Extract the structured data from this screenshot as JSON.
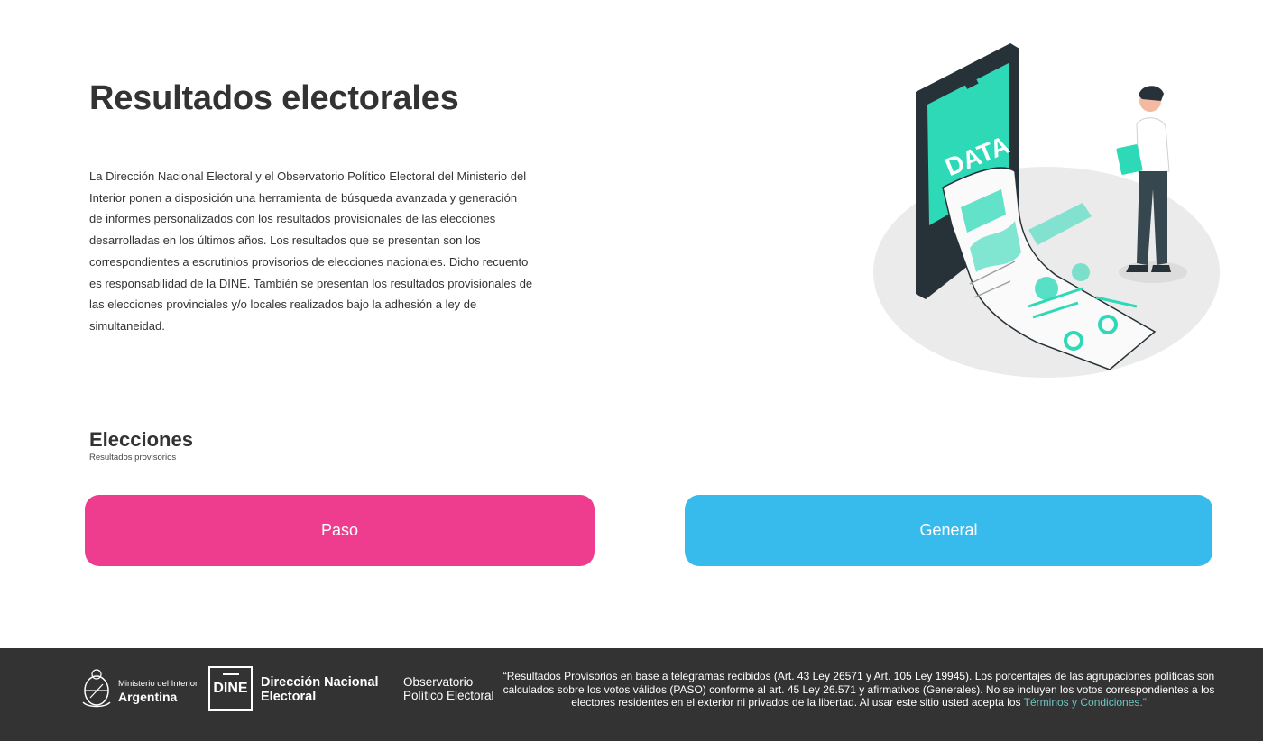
{
  "header": {
    "title": "Resultados electorales",
    "intro": "La Dirección Nacional Electoral y el Observatorio Político Electoral del Ministerio del Interior ponen a disposición una herramienta de búsqueda avanzada y generación de informes personalizados con los resultados provisionales de las elecciones desarrolladas en los últimos años. Los resultados que se presentan son los correspondientes a escrutinios provisorios de elecciones nacionales. Dicho recuento es responsabilidad de la DINE. También se presentan los resultados provisionales de las elecciones provinciales y/o locales realizados bajo la adhesión a ley de simultaneidad."
  },
  "illustration": {
    "screen_text": "DATA"
  },
  "elections": {
    "title": "Elecciones",
    "subtitle": "Resultados provisorios",
    "buttons": [
      {
        "label": "Paso",
        "color": "#ee3d8f"
      },
      {
        "label": "General",
        "color": "#37bbed"
      }
    ]
  },
  "footer": {
    "background": "#333333",
    "ministry_line1": "Ministerio del Interior",
    "ministry_line2": "Argentina",
    "dine_label": "DINE",
    "dne_line1": "Dirección Nacional",
    "dne_line2": "Electoral",
    "obs_line1": "Observatorio",
    "obs_line2": "Político Electoral",
    "disclaimer_text": "“Resultados Provisorios en base a telegramas recibidos (Art. 43 Ley 26571 y Art. 105 Ley 19945). Los porcentajes de las agrupaciones políticas son calculados sobre los votos válidos (PASO) conforme al art. 45 Ley 26.571 y afirmativos (Generales). No se incluyen los votos correspondientes a los electores residentes en el exterior ni privados de la libertad. Al usar este sitio usted acepta los ",
    "terms_link": "Términos y Condiciones.",
    "disclaimer_end": "”",
    "link_color": "#6cc5c0"
  }
}
